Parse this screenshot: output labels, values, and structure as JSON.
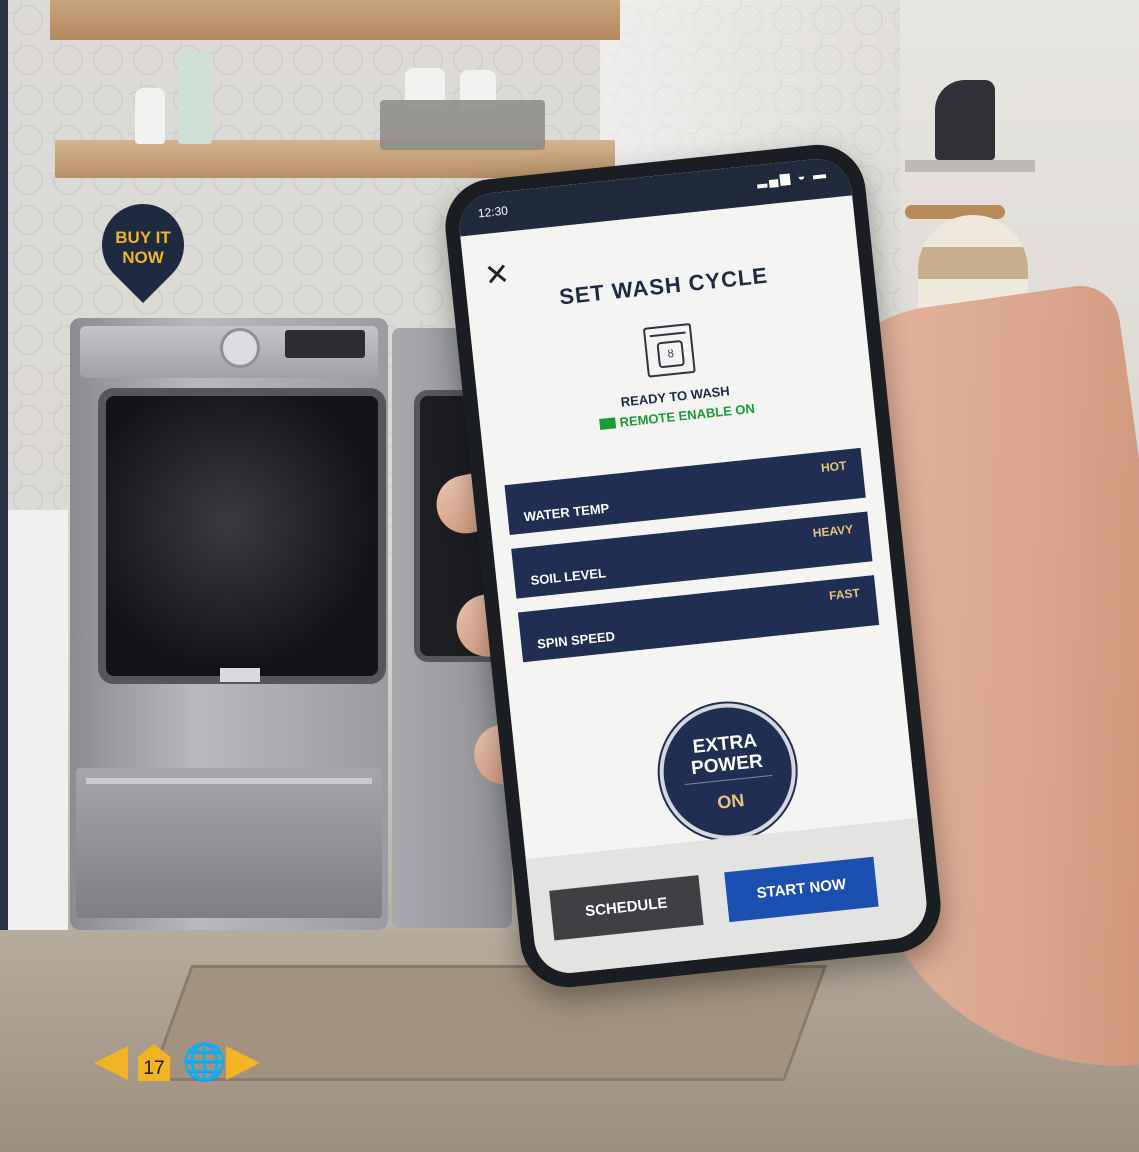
{
  "promo": {
    "buy_line1": "BUY IT",
    "buy_line2": "NOW"
  },
  "phone": {
    "status_time": "12:30",
    "status_icons": "▂▄▆ ◒ ▬",
    "close_glyph": "✕",
    "title": "SET WASH CYCLE",
    "drum_glyph": "ȣ",
    "state": "READY TO WASH",
    "remote": "REMOTE ENABLE ON",
    "settings": [
      {
        "label": "WATER TEMP",
        "value": "HOT"
      },
      {
        "label": "SOIL LEVEL",
        "value": "HEAVY"
      },
      {
        "label": "SPIN SPEED",
        "value": "FAST"
      }
    ],
    "extra_power": {
      "label_line1": "EXTRA",
      "label_line2": "POWER",
      "status": "ON"
    },
    "buttons": {
      "schedule": "SCHEDULE",
      "start": "START NOW"
    }
  },
  "nav": {
    "page_number": "17",
    "globe_glyph": "🌐"
  },
  "colors": {
    "navy": "#1f2e52",
    "accent_gold": "#f2b324",
    "value_gold": "#e9c27c",
    "remote_green": "#1a9b35",
    "start_blue": "#1b50b0"
  }
}
